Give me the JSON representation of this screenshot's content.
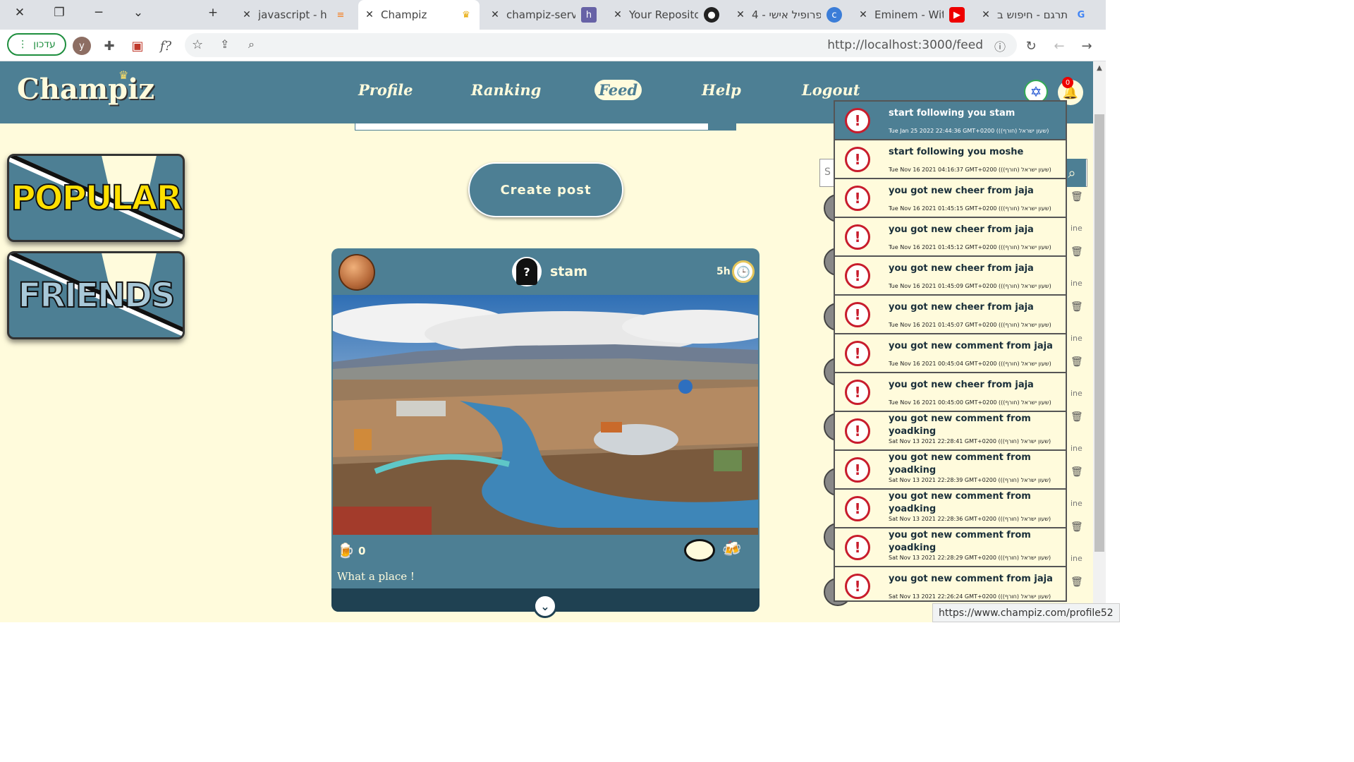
{
  "browser": {
    "tabs": [
      {
        "title": "javascript - ho",
        "icon": "stackoverflow-icon"
      },
      {
        "title": "Champiz",
        "icon": "crown-icon",
        "active": true
      },
      {
        "title": "champiz-serve",
        "icon": "heroku-icon"
      },
      {
        "title": "Your Reposito",
        "icon": "github-icon"
      },
      {
        "title": "פרופיל אישי - 4",
        "icon": "c-icon"
      },
      {
        "title": "Eminem - With",
        "icon": "youtube-icon"
      },
      {
        "title": "תרגם - חיפוש ב",
        "icon": "google-icon"
      }
    ],
    "update_label": "עדכון",
    "profile_initial": "y",
    "formula_label": "f?",
    "url": "http://localhost:3000/feed",
    "status_url": "https://www.champiz.com/profile52"
  },
  "nav": {
    "logo": "Champiz",
    "links": [
      "Profile",
      "Ranking",
      "Feed",
      "Help",
      "Logout"
    ],
    "active": "Feed",
    "notif_count": "0"
  },
  "sidebar": {
    "popular": "POPULAR",
    "friends": "FRIENDS"
  },
  "feed": {
    "create_label": "Create post",
    "post": {
      "username": "stam",
      "time": "5h",
      "avatar_glyph": "?",
      "cheers": "0",
      "caption": "What a place !"
    }
  },
  "right_panel": {
    "search_placeholder": "S",
    "line_label": "ine"
  },
  "notifications": [
    {
      "message": "start following you stam",
      "date": "Tue Jan 25 2022 22:44:36 GMT+0200 ((שעון ישראל (חורף))"
    },
    {
      "message": "start following you moshe",
      "date": "Tue Nov 16 2021 04:16:37 GMT+0200 ((שעון ישראל (חורף))"
    },
    {
      "message": "you got new cheer from jaja",
      "date": "Tue Nov 16 2021 01:45:15 GMT+0200 ((שעון ישראל (חורף))"
    },
    {
      "message": "you got new cheer from jaja",
      "date": "Tue Nov 16 2021 01:45:12 GMT+0200 ((שעון ישראל (חורף))"
    },
    {
      "message": "you got new cheer from jaja",
      "date": "Tue Nov 16 2021 01:45:09 GMT+0200 ((שעון ישראל (חורף))"
    },
    {
      "message": "you got new cheer from jaja",
      "date": "Tue Nov 16 2021 01:45:07 GMT+0200 ((שעון ישראל (חורף))"
    },
    {
      "message": "you got new comment from jaja",
      "date": "Tue Nov 16 2021 00:45:04 GMT+0200 ((שעון ישראל (חורף))"
    },
    {
      "message": "you got new cheer from jaja",
      "date": "Tue Nov 16 2021 00:45:00 GMT+0200 ((שעון ישראל (חורף))"
    },
    {
      "message": "you got new comment from yoadking",
      "date": "Sat Nov 13 2021 22:28:41 GMT+0200 ((שעון ישראל (חורף))"
    },
    {
      "message": "you got new comment from yoadking",
      "date": "Sat Nov 13 2021 22:28:39 GMT+0200 ((שעון ישראל (חורף))"
    },
    {
      "message": "you got new comment from yoadking",
      "date": "Sat Nov 13 2021 22:28:36 GMT+0200 ((שעון ישראל (חורף))"
    },
    {
      "message": "you got new comment from yoadking",
      "date": "Sat Nov 13 2021 22:28:29 GMT+0200 ((שעון ישראל (חורף))"
    },
    {
      "message": "you got new comment from jaja",
      "date": "Sat Nov 13 2021 22:26:24 GMT+0200 ((שעון ישראל (חורף))"
    }
  ],
  "colors": {
    "primary": "#4d7f94",
    "background": "#fffbdc",
    "alert": "#c81c2c"
  }
}
